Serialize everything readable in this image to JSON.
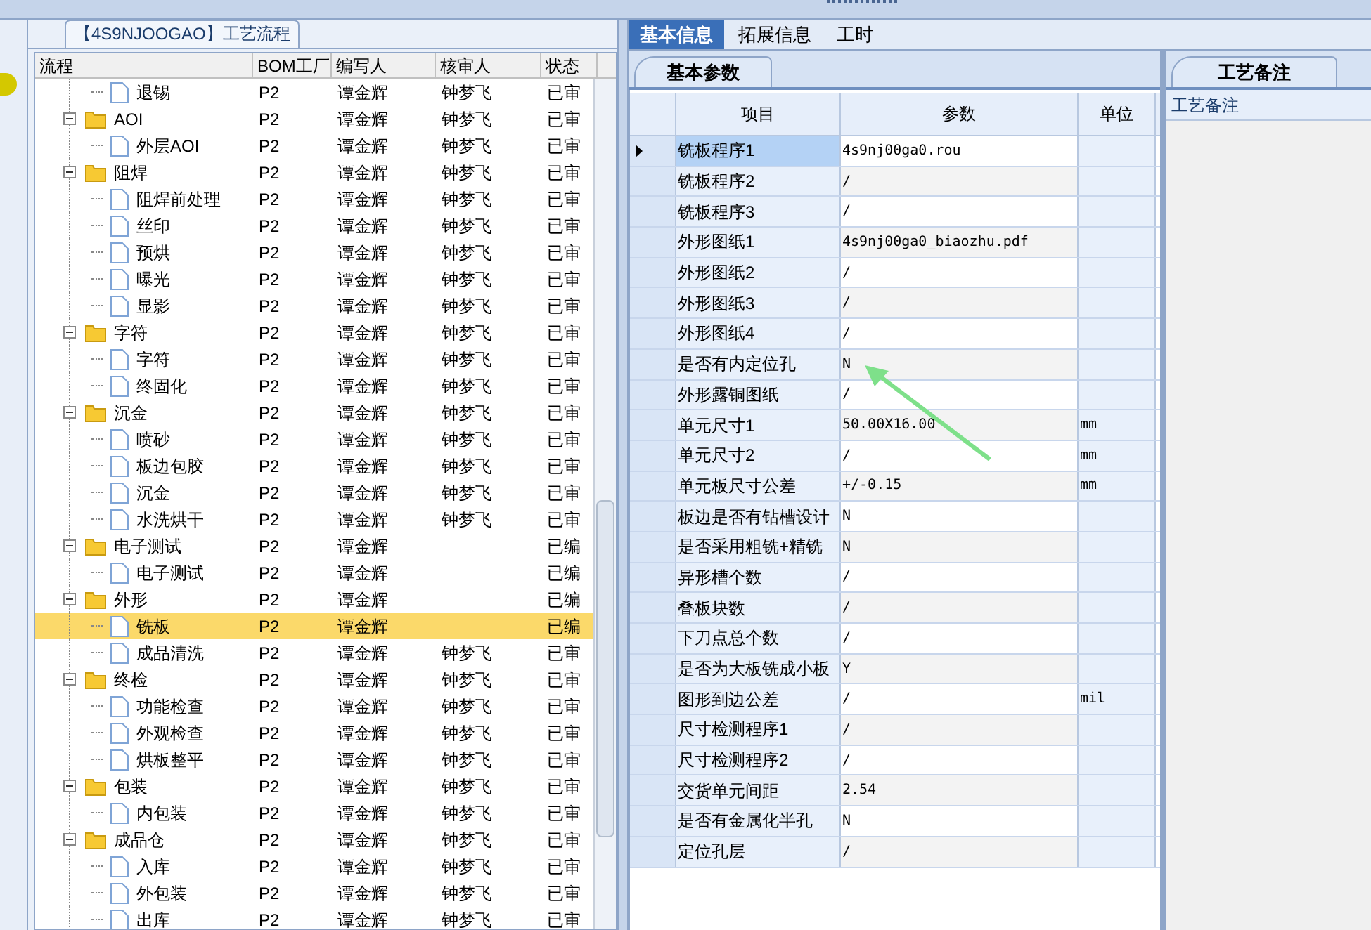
{
  "process_panel": {
    "title": "【4S9NJOOGAO】工艺流程",
    "columns": [
      "流程",
      "BOM工厂",
      "编写人",
      "核审人",
      "状态"
    ],
    "nodes": [
      {
        "kind": "file",
        "label": "退锡",
        "bom": "P2",
        "author": "谭金辉",
        "reviewer": "钟梦飞",
        "status": "已审",
        "selected": false
      },
      {
        "kind": "folder",
        "label": "AOI",
        "bom": "P2",
        "author": "谭金辉",
        "reviewer": "钟梦飞",
        "status": "已审",
        "selected": false,
        "expanded": true,
        "children": [
          {
            "kind": "file",
            "label": "外层AOI",
            "bom": "P2",
            "author": "谭金辉",
            "reviewer": "钟梦飞",
            "status": "已审",
            "selected": false
          }
        ]
      },
      {
        "kind": "folder",
        "label": "阻焊",
        "bom": "P2",
        "author": "谭金辉",
        "reviewer": "钟梦飞",
        "status": "已审",
        "selected": false,
        "expanded": true,
        "children": [
          {
            "kind": "file",
            "label": "阻焊前处理",
            "bom": "P2",
            "author": "谭金辉",
            "reviewer": "钟梦飞",
            "status": "已审",
            "selected": false
          },
          {
            "kind": "file",
            "label": "丝印",
            "bom": "P2",
            "author": "谭金辉",
            "reviewer": "钟梦飞",
            "status": "已审",
            "selected": false
          },
          {
            "kind": "file",
            "label": "预烘",
            "bom": "P2",
            "author": "谭金辉",
            "reviewer": "钟梦飞",
            "status": "已审",
            "selected": false
          },
          {
            "kind": "file",
            "label": "曝光",
            "bom": "P2",
            "author": "谭金辉",
            "reviewer": "钟梦飞",
            "status": "已审",
            "selected": false
          },
          {
            "kind": "file",
            "label": "显影",
            "bom": "P2",
            "author": "谭金辉",
            "reviewer": "钟梦飞",
            "status": "已审",
            "selected": false
          }
        ]
      },
      {
        "kind": "folder",
        "label": "字符",
        "bom": "P2",
        "author": "谭金辉",
        "reviewer": "钟梦飞",
        "status": "已审",
        "selected": false,
        "expanded": true,
        "children": [
          {
            "kind": "file",
            "label": "字符",
            "bom": "P2",
            "author": "谭金辉",
            "reviewer": "钟梦飞",
            "status": "已审",
            "selected": false
          },
          {
            "kind": "file",
            "label": "终固化",
            "bom": "P2",
            "author": "谭金辉",
            "reviewer": "钟梦飞",
            "status": "已审",
            "selected": false
          }
        ]
      },
      {
        "kind": "folder",
        "label": "沉金",
        "bom": "P2",
        "author": "谭金辉",
        "reviewer": "钟梦飞",
        "status": "已审",
        "selected": false,
        "expanded": true,
        "children": [
          {
            "kind": "file",
            "label": "喷砂",
            "bom": "P2",
            "author": "谭金辉",
            "reviewer": "钟梦飞",
            "status": "已审",
            "selected": false
          },
          {
            "kind": "file",
            "label": "板边包胶",
            "bom": "P2",
            "author": "谭金辉",
            "reviewer": "钟梦飞",
            "status": "已审",
            "selected": false
          },
          {
            "kind": "file",
            "label": "沉金",
            "bom": "P2",
            "author": "谭金辉",
            "reviewer": "钟梦飞",
            "status": "已审",
            "selected": false
          },
          {
            "kind": "file",
            "label": "水洗烘干",
            "bom": "P2",
            "author": "谭金辉",
            "reviewer": "钟梦飞",
            "status": "已审",
            "selected": false
          }
        ]
      },
      {
        "kind": "folder",
        "label": "电子测试",
        "bom": "P2",
        "author": "谭金辉",
        "status": "已编",
        "selected": false,
        "expanded": true,
        "children": [
          {
            "kind": "file",
            "label": "电子测试",
            "bom": "P2",
            "author": "谭金辉",
            "status": "已编",
            "selected": false
          }
        ]
      },
      {
        "kind": "folder",
        "label": "外形",
        "bom": "P2",
        "author": "谭金辉",
        "status": "已编",
        "selected": false,
        "expanded": true,
        "children": [
          {
            "kind": "file",
            "label": "铣板",
            "bom": "P2",
            "author": "谭金辉",
            "status": "已编",
            "selected": true
          },
          {
            "kind": "file",
            "label": "成品清洗",
            "bom": "P2",
            "author": "谭金辉",
            "reviewer": "钟梦飞",
            "status": "已审",
            "selected": false
          }
        ]
      },
      {
        "kind": "folder",
        "label": "终检",
        "bom": "P2",
        "author": "谭金辉",
        "reviewer": "钟梦飞",
        "status": "已审",
        "selected": false,
        "expanded": true,
        "children": [
          {
            "kind": "file",
            "label": "功能检查",
            "bom": "P2",
            "author": "谭金辉",
            "reviewer": "钟梦飞",
            "status": "已审",
            "selected": false
          },
          {
            "kind": "file",
            "label": "外观检查",
            "bom": "P2",
            "author": "谭金辉",
            "reviewer": "钟梦飞",
            "status": "已审",
            "selected": false
          },
          {
            "kind": "file",
            "label": "烘板整平",
            "bom": "P2",
            "author": "谭金辉",
            "reviewer": "钟梦飞",
            "status": "已审",
            "selected": false
          }
        ]
      },
      {
        "kind": "folder",
        "label": "包装",
        "bom": "P2",
        "author": "谭金辉",
        "reviewer": "钟梦飞",
        "status": "已审",
        "selected": false,
        "expanded": true,
        "children": [
          {
            "kind": "file",
            "label": "内包装",
            "bom": "P2",
            "author": "谭金辉",
            "reviewer": "钟梦飞",
            "status": "已审",
            "selected": false
          }
        ]
      },
      {
        "kind": "folder",
        "label": "成品仓",
        "bom": "P2",
        "author": "谭金辉",
        "reviewer": "钟梦飞",
        "status": "已审",
        "selected": false,
        "expanded": true,
        "children": [
          {
            "kind": "file",
            "label": "入库",
            "bom": "P2",
            "author": "谭金辉",
            "reviewer": "钟梦飞",
            "status": "已审",
            "selected": false
          },
          {
            "kind": "file",
            "label": "外包装",
            "bom": "P2",
            "author": "谭金辉",
            "reviewer": "钟梦飞",
            "status": "已审",
            "selected": false
          },
          {
            "kind": "file",
            "label": "出库",
            "bom": "P2",
            "author": "谭金辉",
            "reviewer": "钟梦飞",
            "status": "已审",
            "selected": false
          }
        ]
      }
    ]
  },
  "tabs": [
    {
      "label": "基本信息",
      "selected": true
    },
    {
      "label": "拓展信息",
      "selected": false
    },
    {
      "label": "工时",
      "selected": false
    }
  ],
  "params_panel": {
    "tab": "基本参数",
    "columns": [
      "项目",
      "参数",
      "单位"
    ],
    "rows": [
      {
        "item": "铣板程序1",
        "value": "4s9nj00ga0.rou",
        "selected": true
      },
      {
        "item": "铣板程序2",
        "value": "/",
        "selected": false
      },
      {
        "item": "铣板程序3",
        "value": "/",
        "selected": false
      },
      {
        "item": "外形图纸1",
        "value": "4s9nj00ga0_biaozhu.pdf",
        "selected": false
      },
      {
        "item": "外形图纸2",
        "value": "/",
        "selected": false
      },
      {
        "item": "外形图纸3",
        "value": "/",
        "selected": false
      },
      {
        "item": "外形图纸4",
        "value": "/",
        "selected": false
      },
      {
        "item": "是否有内定位孔",
        "value": "N",
        "selected": false
      },
      {
        "item": "外形露铜图纸",
        "value": "/",
        "selected": false
      },
      {
        "item": "单元尺寸1",
        "value": "50.00X16.00",
        "unit": "mm",
        "selected": false
      },
      {
        "item": "单元尺寸2",
        "value": "/",
        "unit": "mm",
        "selected": false
      },
      {
        "item": "单元板尺寸公差",
        "value": "+/-0.15",
        "unit": "mm",
        "selected": false
      },
      {
        "item": "板边是否有钻槽设计",
        "value": "N",
        "selected": false
      },
      {
        "item": "是否采用粗铣+精铣",
        "value": "N",
        "selected": false
      },
      {
        "item": "异形槽个数",
        "value": "/",
        "selected": false
      },
      {
        "item": "叠板块数",
        "value": "/",
        "selected": false
      },
      {
        "item": "下刀点总个数",
        "value": "/",
        "selected": false
      },
      {
        "item": "是否为大板铣成小板",
        "value": "Y",
        "selected": false
      },
      {
        "item": "图形到边公差",
        "value": "/",
        "unit": "mil",
        "selected": false
      },
      {
        "item": "尺寸检测程序1",
        "value": "/",
        "selected": false
      },
      {
        "item": "尺寸检测程序2",
        "value": "/",
        "selected": false
      },
      {
        "item": "交货单元间距",
        "value": "2.54",
        "selected": false
      },
      {
        "item": "是否有金属化半孔",
        "value": "N",
        "selected": false
      },
      {
        "item": "定位孔层",
        "value": "/",
        "selected": false
      }
    ]
  },
  "notes_panel": {
    "tab": "工艺备注",
    "column": "工艺备注"
  }
}
